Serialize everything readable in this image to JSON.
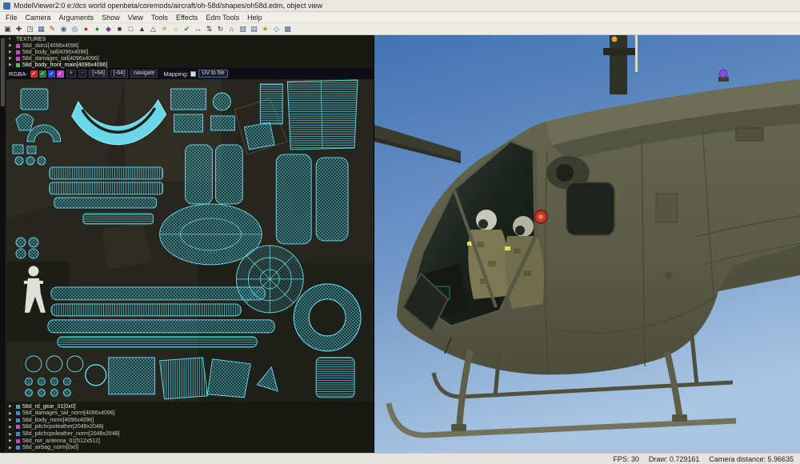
{
  "window": {
    "title": "ModelViewer2:0 e:/dcs world openbeta/coremods/aircraft/oh-58d/shapes/oh58d.edm, object view"
  },
  "menubar": {
    "items": [
      "File",
      "Camera",
      "Arguments",
      "Show",
      "View",
      "Tools",
      "Effects",
      "Edm Tools",
      "Help"
    ]
  },
  "toolbar": {
    "icons": [
      {
        "glyph": "▣",
        "color": "#3c3c3c"
      },
      {
        "glyph": "✚",
        "color": "#3c3c3c"
      },
      {
        "glyph": "◳",
        "color": "#3c3c3c"
      },
      {
        "glyph": "▦",
        "color": "#4a5a8a"
      },
      {
        "glyph": "✎",
        "color": "#7a5a2a"
      },
      {
        "glyph": "◉",
        "color": "#2e6e9e"
      },
      {
        "glyph": "◎",
        "color": "#2e6e9e"
      },
      {
        "glyph": "●",
        "color": "#b03030"
      },
      {
        "glyph": "●",
        "color": "#2e8e2e"
      },
      {
        "glyph": "◆",
        "color": "#7040a0"
      },
      {
        "glyph": "■",
        "color": "#3c3c3c"
      },
      {
        "glyph": "□",
        "color": "#3c3c3c"
      },
      {
        "glyph": "▲",
        "color": "#3c3c3c"
      },
      {
        "glyph": "△",
        "color": "#3c3c3c"
      },
      {
        "glyph": "☀",
        "color": "#c09020"
      },
      {
        "glyph": "☼",
        "color": "#c09020"
      },
      {
        "glyph": "✔",
        "color": "#2e8e2e"
      },
      {
        "glyph": "↔",
        "color": "#3c3c3c"
      },
      {
        "glyph": "⇅",
        "color": "#3c3c3c"
      },
      {
        "glyph": "↻",
        "color": "#3c3c3c"
      },
      {
        "glyph": "⌂",
        "color": "#3c3c3c"
      },
      {
        "glyph": "▧",
        "color": "#4a5a8a"
      },
      {
        "glyph": "▤",
        "color": "#4a5a8a"
      },
      {
        "glyph": "★",
        "color": "#c09020"
      },
      {
        "glyph": "◇",
        "color": "#2e6e9e"
      },
      {
        "glyph": "▩",
        "color": "#4a5a8a"
      }
    ]
  },
  "texture_panel": {
    "header": "TEXTURES",
    "header_arrow": "▾",
    "top_items": [
      {
        "arrow": "▶",
        "label": "58d_skin1[4096x4096]",
        "swatch": "#c050c0",
        "text": "#c9c9bf"
      },
      {
        "arrow": "▶",
        "label": "58d_body_tail[4096x4096]",
        "swatch": "#c050c0",
        "text": "#c9c9bf"
      },
      {
        "arrow": "▶",
        "label": "58d_damages_tail[4096x4096]",
        "swatch": "#c050c0",
        "text": "#c9c9bf"
      },
      {
        "arrow": "▶",
        "label": "58d_body_front_main[4096x4096]",
        "swatch": "#50c050",
        "text": "#ffffff"
      }
    ],
    "rgba": {
      "label": "RGBA-",
      "channels": [
        {
          "color": "#cc3333",
          "check": "✓"
        },
        {
          "color": "#2e7d32",
          "check": "✓"
        },
        {
          "color": "#3344cc",
          "check": "✓"
        },
        {
          "color": "#bb44bb",
          "check": "✓"
        }
      ],
      "plus": "+",
      "minus": "-",
      "plus64": "[+64]",
      "minus64": "[-64]",
      "navigate": "navigate",
      "mapping_label": "Mapping:",
      "uv_to_file": "UV to file"
    },
    "bottom_items": [
      {
        "arrow": "▶",
        "label": "58d_rd_gear_01[0x0]",
        "swatch": "#44aaaa",
        "text": "#e8e8e0"
      },
      {
        "arrow": "▶",
        "label": "58d_damages_tail_norm[4096x4096]",
        "swatch": "#4488cc",
        "text": "#c9c9bf"
      },
      {
        "arrow": "▶",
        "label": "58d_body_norm[4096x4096]",
        "swatch": "#4488cc",
        "text": "#c9c9bf"
      },
      {
        "arrow": "▶",
        "label": "58d_pitchcpoleather[2048x2048]",
        "swatch": "#c050c0",
        "text": "#c9c9bf"
      },
      {
        "arrow": "▶",
        "label": "58d_pitchcpoleather_norm[2048x2048]",
        "swatch": "#4488cc",
        "text": "#c9c9bf"
      },
      {
        "arrow": "▶",
        "label": "58d_rwr_antenna_01[512x512]",
        "swatch": "#c050c0",
        "text": "#c9c9bf"
      },
      {
        "arrow": "▶",
        "label": "58d_airbag_norm[0x0]",
        "swatch": "#4488cc",
        "text": "#c9c9bf"
      }
    ]
  },
  "statusbar": {
    "fps": "FPS: 30",
    "draw": "Draw: 0.729161",
    "camera": "Camera distance: 5.96635"
  },
  "colors": {
    "uv_wire": "#68dcec",
    "sky_top": "#4273b3",
    "sky_bottom": "#aac5e2",
    "hull_olive": "#5a5c47"
  }
}
